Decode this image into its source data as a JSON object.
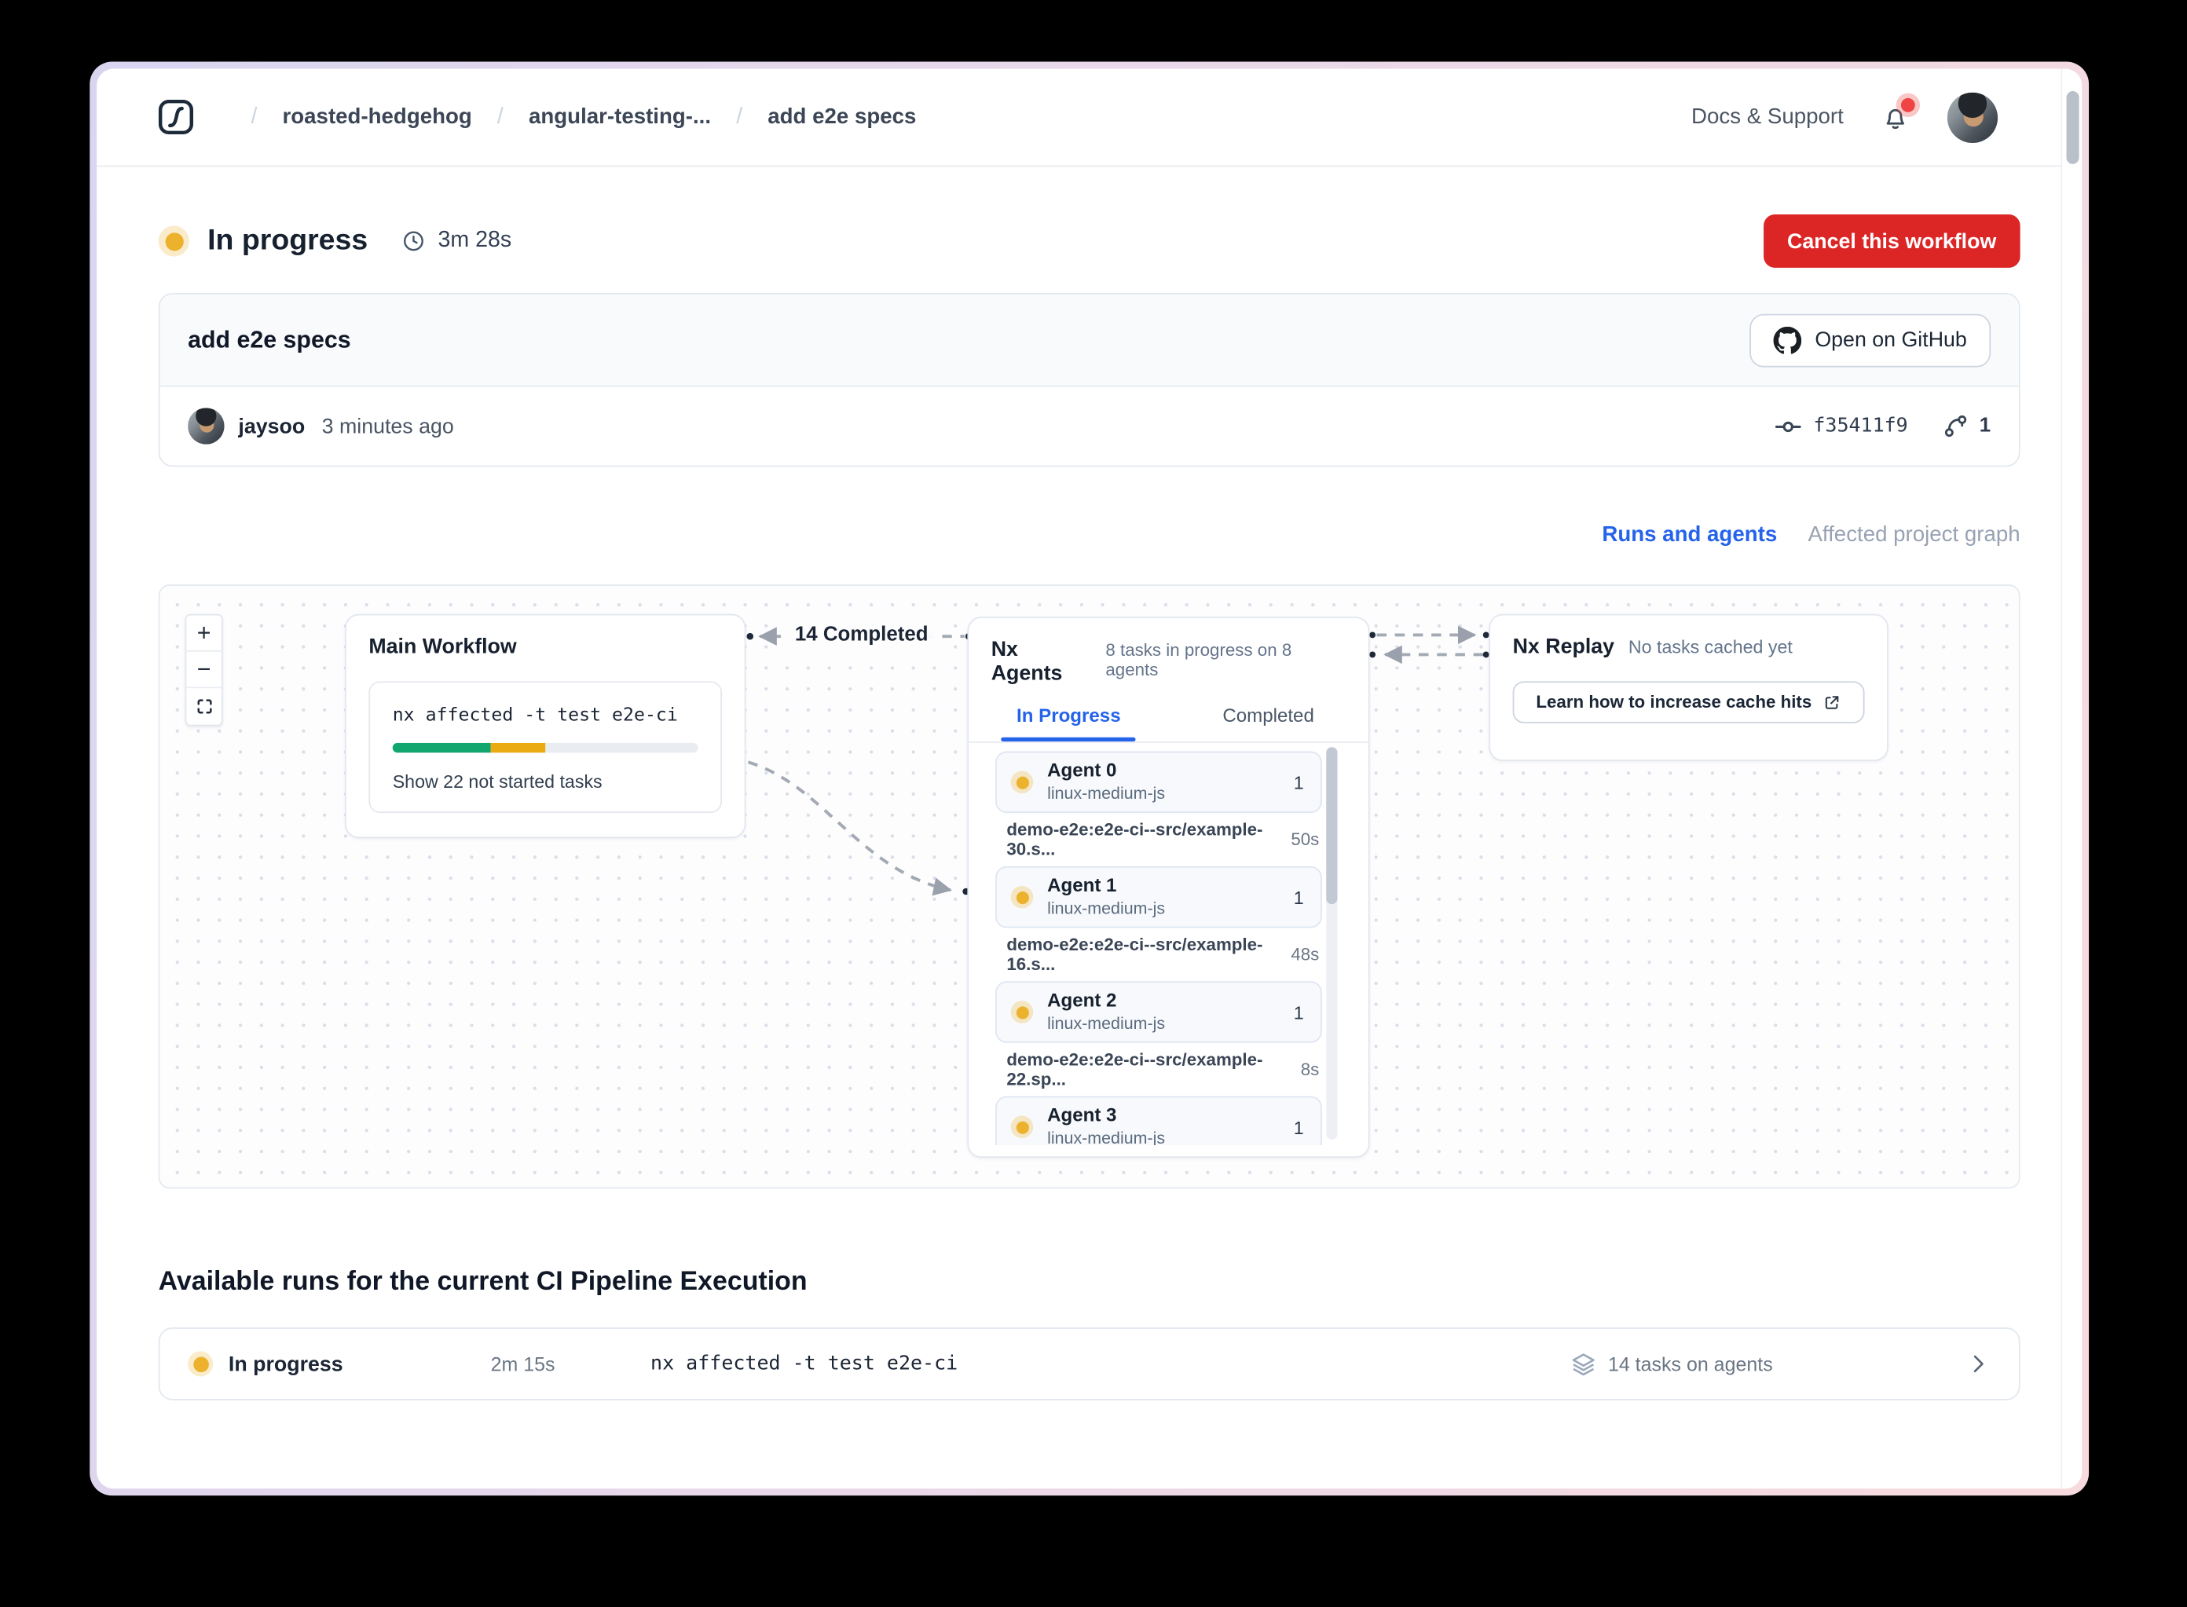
{
  "header": {
    "breadcrumbs": [
      "roasted-hedgehog",
      "angular-testing-...",
      "add e2e specs"
    ],
    "docs_support_label": "Docs & Support"
  },
  "status_bar": {
    "status": "In progress",
    "duration": "3m 28s",
    "cancel_button_label": "Cancel this workflow"
  },
  "commit_card": {
    "title": "add e2e specs",
    "open_github_label": "Open on GitHub",
    "author": "jaysoo",
    "time_ago": "3 minutes ago",
    "commit_hash": "f35411f9",
    "branch_count": "1"
  },
  "view_tabs": {
    "runs_and_agents": "Runs and agents",
    "affected_project_graph": "Affected project graph"
  },
  "graph": {
    "zoom_controls": {
      "zoom_in": "+",
      "zoom_out": "−"
    },
    "main_workflow": {
      "title": "Main Workflow",
      "command": "nx affected -t test e2e-ci",
      "progress": {
        "completed_pct": 32,
        "in_progress_pct": 18
      },
      "show_tasks_label": "Show 22 not started tasks"
    },
    "edge_label": "14 Completed",
    "nx_agents": {
      "title": "Nx Agents",
      "subtitle": "8 tasks in progress on 8 agents",
      "tab_in_progress": "In Progress",
      "tab_completed": "Completed",
      "items": [
        {
          "type": "agent",
          "name": "Agent 0",
          "runtime": "linux-medium-js",
          "count": "1"
        },
        {
          "type": "task",
          "name": "demo-e2e:e2e-ci--src/example-30.s...",
          "duration": "50s"
        },
        {
          "type": "agent",
          "name": "Agent 1",
          "runtime": "linux-medium-js",
          "count": "1"
        },
        {
          "type": "task",
          "name": "demo-e2e:e2e-ci--src/example-16.s...",
          "duration": "48s"
        },
        {
          "type": "agent",
          "name": "Agent 2",
          "runtime": "linux-medium-js",
          "count": "1"
        },
        {
          "type": "task",
          "name": "demo-e2e:e2e-ci--src/example-22.sp...",
          "duration": "8s"
        },
        {
          "type": "agent",
          "name": "Agent 3",
          "runtime": "linux-medium-js",
          "count": "1"
        }
      ]
    },
    "nx_replay": {
      "title": "Nx Replay",
      "subtitle": "No tasks cached yet",
      "button_label": "Learn how to increase cache hits"
    }
  },
  "runs_section": {
    "heading": "Available runs for the current CI Pipeline Execution",
    "runs": [
      {
        "status": "In progress",
        "duration": "2m 15s",
        "command": "nx affected -t test e2e-ci",
        "tasks_label": "14 tasks on agents"
      }
    ]
  },
  "colors": {
    "status_in_progress": "#ecb22e",
    "cancel_red": "#dc2626",
    "accent_blue": "#2563eb",
    "progress_green": "#12a66f",
    "progress_yellow": "#e9ab11",
    "notification_red": "#ef4444"
  }
}
